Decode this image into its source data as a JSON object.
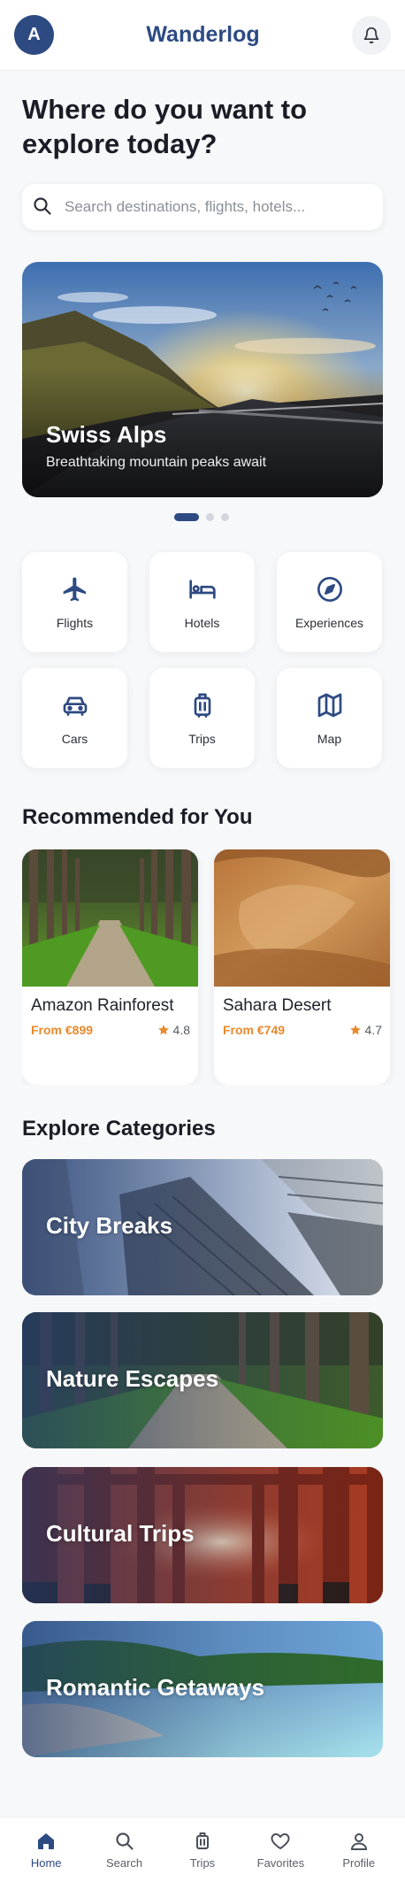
{
  "header": {
    "avatar_initial": "A",
    "brand": "Wanderlog"
  },
  "greeting": "Where do you want to explore today?",
  "search": {
    "placeholder": "Search destinations, flights, hotels..."
  },
  "hero": {
    "title": "Swiss Alps",
    "subtitle": "Breathtaking mountain peaks await",
    "slide_count": 3,
    "active_slide": 1
  },
  "categories": [
    {
      "label": "Flights",
      "icon": "plane-icon"
    },
    {
      "label": "Hotels",
      "icon": "bed-icon"
    },
    {
      "label": "Experiences",
      "icon": "compass-icon"
    },
    {
      "label": "Cars",
      "icon": "car-icon"
    },
    {
      "label": "Trips",
      "icon": "suitcase-icon"
    },
    {
      "label": "Map",
      "icon": "map-icon"
    }
  ],
  "recommended": {
    "title": "Recommended for You",
    "items": [
      {
        "name": "Amazon Rainforest",
        "price": "From €899",
        "rating": "4.8"
      },
      {
        "name": "Sahara Desert",
        "price": "From €749",
        "rating": "4.7"
      }
    ]
  },
  "explore": {
    "title": "Explore Categories",
    "items": [
      {
        "label": "City Breaks"
      },
      {
        "label": "Nature Escapes"
      },
      {
        "label": "Cultural Trips"
      },
      {
        "label": "Romantic Getaways"
      }
    ]
  },
  "nav": {
    "items": [
      {
        "label": "Home",
        "icon": "home-icon",
        "active": true
      },
      {
        "label": "Search",
        "icon": "search-icon",
        "active": false
      },
      {
        "label": "Trips",
        "icon": "suitcase-icon",
        "active": false
      },
      {
        "label": "Favorites",
        "icon": "heart-icon",
        "active": false
      },
      {
        "label": "Profile",
        "icon": "user-icon",
        "active": false
      }
    ]
  },
  "colors": {
    "brand": "#2d4a82",
    "accent_price": "#e8892b",
    "star": "#e8892b",
    "background": "#f7f8fa"
  }
}
